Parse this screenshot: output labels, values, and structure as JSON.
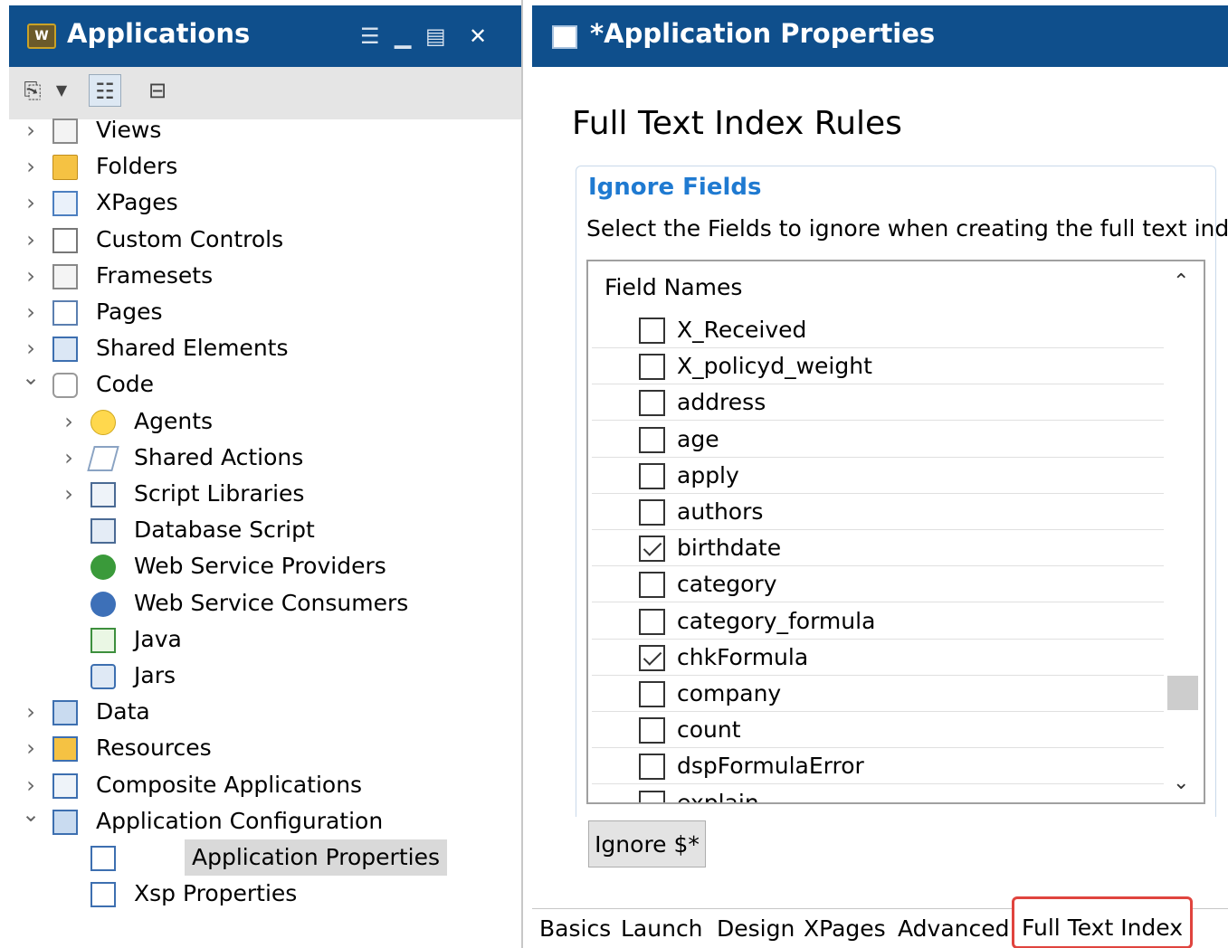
{
  "left_panel": {
    "title": "Applications",
    "tree": [
      {
        "label": "Views",
        "icon": "views-icon",
        "expanded": false,
        "level": 0
      },
      {
        "label": "Folders",
        "icon": "folder-icon",
        "expanded": false,
        "level": 0
      },
      {
        "label": "XPages",
        "icon": "xpages-icon",
        "expanded": false,
        "level": 0
      },
      {
        "label": "Custom Controls",
        "icon": "custom-controls-icon",
        "expanded": false,
        "level": 0
      },
      {
        "label": "Framesets",
        "icon": "framesets-icon",
        "expanded": false,
        "level": 0
      },
      {
        "label": "Pages",
        "icon": "page-icon",
        "expanded": false,
        "level": 0
      },
      {
        "label": "Shared Elements",
        "icon": "shared-elements-icon",
        "expanded": false,
        "level": 0
      },
      {
        "label": "Code",
        "icon": "code-icon",
        "expanded": true,
        "level": 0
      },
      {
        "label": "Agents",
        "icon": "agent-bulb-icon",
        "expanded": false,
        "level": 1
      },
      {
        "label": "Shared Actions",
        "icon": "lightning-icon",
        "expanded": false,
        "level": 1
      },
      {
        "label": "Script Libraries",
        "icon": "script-library-icon",
        "expanded": false,
        "level": 1
      },
      {
        "label": "Database Script",
        "icon": "database-script-icon",
        "level": 1
      },
      {
        "label": "Web Service Providers",
        "icon": "web-service-provider-icon",
        "level": 1
      },
      {
        "label": "Web Service Consumers",
        "icon": "web-service-consumer-icon",
        "level": 1
      },
      {
        "label": "Java",
        "icon": "java-icon",
        "level": 1
      },
      {
        "label": "Jars",
        "icon": "jar-icon",
        "level": 1
      },
      {
        "label": "Data",
        "icon": "data-icon",
        "expanded": false,
        "level": 0
      },
      {
        "label": "Resources",
        "icon": "resources-icon",
        "expanded": false,
        "level": 0
      },
      {
        "label": "Composite Applications",
        "icon": "composite-apps-icon",
        "expanded": false,
        "level": 0
      },
      {
        "label": "Application Configuration",
        "icon": "app-config-icon",
        "expanded": true,
        "level": 0
      },
      {
        "label": "Application Properties",
        "icon": "app-properties-icon",
        "level": 1,
        "selected": true
      },
      {
        "label": "Xsp Properties",
        "icon": "xsp-properties-icon",
        "level": 1
      }
    ]
  },
  "right_panel": {
    "title": "*Application Properties",
    "page_title": "Full Text Index Rules",
    "section_title": "Ignore Fields",
    "section_desc": "Select the Fields to ignore when creating the full text index",
    "table_header": "Field Names",
    "fields": [
      {
        "name": "X_Received",
        "checked": false
      },
      {
        "name": "X_policyd_weight",
        "checked": false
      },
      {
        "name": "address",
        "checked": false
      },
      {
        "name": "age",
        "checked": false
      },
      {
        "name": "apply",
        "checked": false
      },
      {
        "name": "authors",
        "checked": false
      },
      {
        "name": "birthdate",
        "checked": true
      },
      {
        "name": "category",
        "checked": false
      },
      {
        "name": "category_formula",
        "checked": false
      },
      {
        "name": "chkFormula",
        "checked": true
      },
      {
        "name": "company",
        "checked": false
      },
      {
        "name": "count",
        "checked": false
      },
      {
        "name": "dspFormulaError",
        "checked": false
      },
      {
        "name": "explain",
        "checked": false
      }
    ],
    "ignore_button": "Ignore $*",
    "tabs": [
      "Basics",
      "Launch",
      "Design",
      "XPages",
      "Advanced",
      "Full Text Index"
    ],
    "active_tab": "Full Text Index"
  },
  "colors": {
    "header_bg": "#0f4f8c",
    "link_blue": "#1f7ad1",
    "highlight_red": "#e0443e",
    "selection_bg": "#d9d9d9"
  }
}
